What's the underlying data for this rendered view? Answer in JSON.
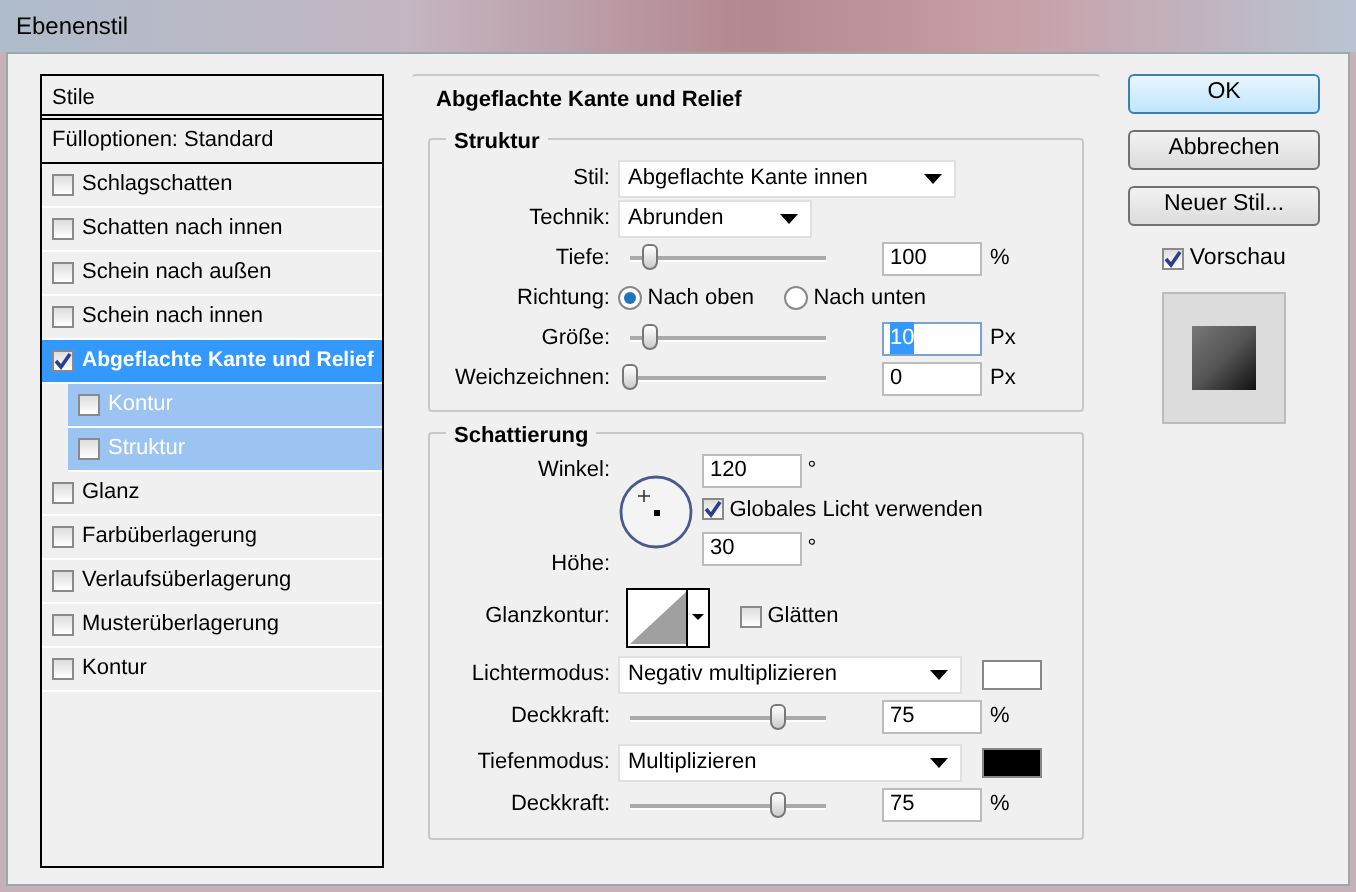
{
  "window": {
    "title": "Ebenenstil"
  },
  "styles_list": {
    "header": "Stile",
    "items": [
      {
        "kind": "header",
        "label": "Fülloptionen: Standard",
        "selected": false
      },
      {
        "kind": "option",
        "label": "Schlagschatten",
        "checked": false,
        "selected": false
      },
      {
        "kind": "option",
        "label": "Schatten nach innen",
        "checked": false,
        "selected": false
      },
      {
        "kind": "option",
        "label": "Schein nach außen",
        "checked": false,
        "selected": false
      },
      {
        "kind": "option",
        "label": "Schein nach innen",
        "checked": false,
        "selected": false
      },
      {
        "kind": "option",
        "label": "Abgeflachte Kante und Relief",
        "checked": true,
        "selected": true,
        "children": [
          {
            "label": "Kontur",
            "checked": false
          },
          {
            "label": "Struktur",
            "checked": false
          }
        ]
      },
      {
        "kind": "option",
        "label": "Glanz",
        "checked": false,
        "selected": false
      },
      {
        "kind": "option",
        "label": "Farbüberlagerung",
        "checked": false,
        "selected": false
      },
      {
        "kind": "option",
        "label": "Verlaufsüberlagerung",
        "checked": false,
        "selected": false
      },
      {
        "kind": "option",
        "label": "Musterüberlagerung",
        "checked": false,
        "selected": false
      },
      {
        "kind": "option",
        "label": "Kontur",
        "checked": false,
        "selected": false
      }
    ]
  },
  "panel": {
    "title": "Abgeflachte Kante und Relief",
    "struktur": {
      "title": "Struktur",
      "rows": [
        {
          "kind": "select",
          "label": "Stil:",
          "value": "Abgeflachte Kante innen"
        },
        {
          "kind": "select",
          "label": "Technik:",
          "value": "Abrunden"
        },
        {
          "kind": "slider",
          "label": "Tiefe:",
          "level": 0.1,
          "value": "100",
          "unit": "%"
        },
        {
          "kind": "radio",
          "label": "Richtung:",
          "options": [
            {
              "label": "Nach oben",
              "selected": true
            },
            {
              "label": "Nach unten",
              "selected": false
            }
          ]
        },
        {
          "kind": "slider",
          "label": "Größe:",
          "level": 0.1,
          "value": "10",
          "unit": "Px",
          "focused": true
        },
        {
          "kind": "slider",
          "label": "Weichzeichnen:",
          "level": 0,
          "value": "0",
          "unit": "Px"
        }
      ]
    },
    "schattierung": {
      "title": "Schattierung",
      "winkel": {
        "label": "Winkel:",
        "value": "120",
        "unit": "°"
      },
      "global_light": {
        "label": "Globales Licht verwenden",
        "checked": true
      },
      "hoehe": {
        "label": "Höhe:",
        "value": "30",
        "unit": "°"
      },
      "glanzkontur": {
        "label": "Glanzkontur:"
      },
      "glaetten": {
        "label": "Glätten",
        "checked": false
      },
      "rows": [
        {
          "kind": "select",
          "label": "Lichtermodus:",
          "value": "Negativ multiplizieren",
          "color": "#ffffff"
        },
        {
          "kind": "slider",
          "label": "Deckkraft:",
          "level": 0.75,
          "value": "75",
          "unit": "%"
        },
        {
          "kind": "select",
          "label": "Tiefenmodus:",
          "value": "Multiplizieren",
          "color": "#000000"
        },
        {
          "kind": "slider",
          "label": "Deckkraft:",
          "level": 0.75,
          "value": "75",
          "unit": "%"
        }
      ]
    }
  },
  "buttons": [
    {
      "label": "OK",
      "default": true
    },
    {
      "label": "Abbrechen",
      "default": false
    },
    {
      "label": "Neuer Stil...",
      "default": false
    }
  ],
  "preview": {
    "label": "Vorschau",
    "checked": true
  }
}
